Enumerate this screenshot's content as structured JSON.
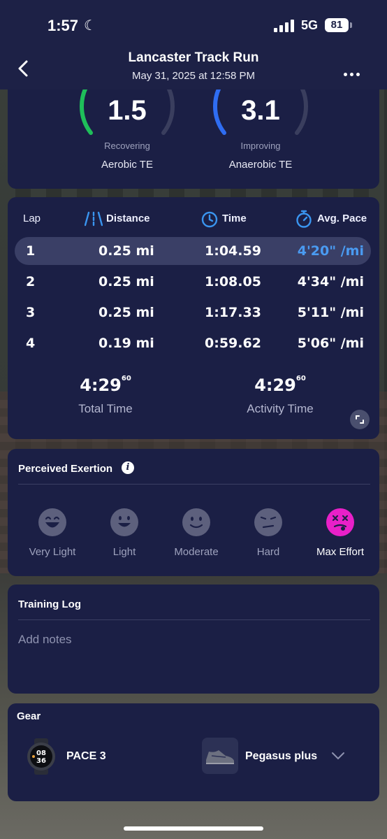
{
  "status_bar": {
    "time": "1:57",
    "network": "5G",
    "battery": "81"
  },
  "header": {
    "title": "Lancaster Track Run",
    "subtitle": "May 31, 2025 at 12:58 PM"
  },
  "training_effect": [
    {
      "value": "1.5",
      "status": "Recovering",
      "label": "Aerobic TE",
      "color": "#1fbf5a"
    },
    {
      "value": "3.1",
      "status": "Improving",
      "label": "Anaerobic TE",
      "color": "#2f6df2"
    }
  ],
  "laps": {
    "headers": {
      "lap": "Lap",
      "distance": "Distance",
      "time": "Time",
      "pace": "Avg. Pace"
    },
    "rows": [
      {
        "lap": "1",
        "distance": "0.25 mi",
        "time": "1:04.59",
        "pace": "4'20\" /mi"
      },
      {
        "lap": "2",
        "distance": "0.25 mi",
        "time": "1:08.05",
        "pace": "4'34\" /mi"
      },
      {
        "lap": "3",
        "distance": "0.25 mi",
        "time": "1:17.33",
        "pace": "5'11\" /mi"
      },
      {
        "lap": "4",
        "distance": "0.19 mi",
        "time": "0:59.62",
        "pace": "5'06\" /mi"
      }
    ],
    "total_time": {
      "value": "4:29",
      "fraction": "60",
      "label": "Total Time"
    },
    "activity_time": {
      "value": "4:29",
      "fraction": "60",
      "label": "Activity Time"
    }
  },
  "exertion": {
    "title": "Perceived Exertion",
    "options": [
      "Very Light",
      "Light",
      "Moderate",
      "Hard",
      "Max Effort"
    ],
    "selected": "Max Effort",
    "selected_color": "#e820c8"
  },
  "training_log": {
    "title": "Training Log",
    "placeholder": "Add notes"
  },
  "gear": {
    "title": "Gear",
    "watch": {
      "name": "PACE 3",
      "face_top": "08",
      "face_bottom": "36"
    },
    "shoe": {
      "name": "Pegasus plus"
    }
  },
  "colors": {
    "accent_blue": "#4a9bf2",
    "card": "#1b1f45",
    "header": "#1d2146"
  }
}
